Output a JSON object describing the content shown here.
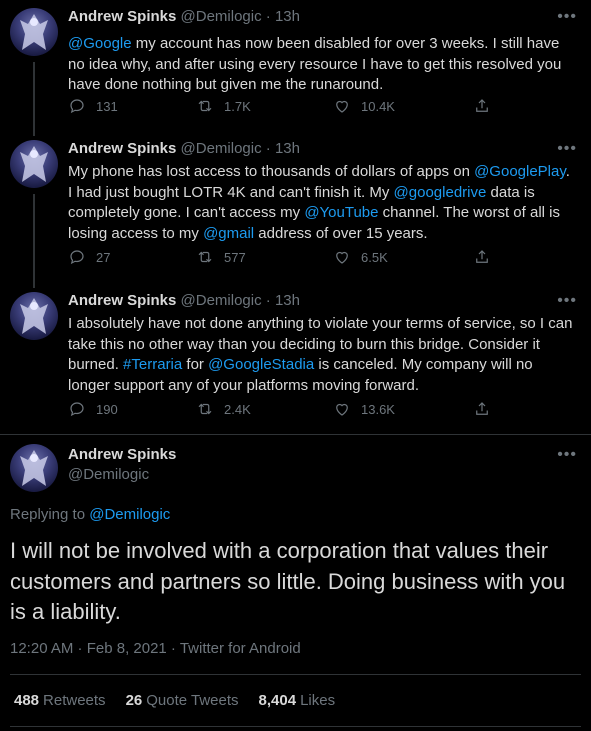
{
  "tweets": [
    {
      "name": "Andrew Spinks",
      "handle": "@Demilogic",
      "dot": "·",
      "time": "13h",
      "text": [
        {
          "t": "@Google",
          "m": true
        },
        {
          "t": " my account has now been disabled for over 3 weeks. I still have no idea why, and after using every resource I have to get this resolved you have done nothing but given me the runaround.",
          "m": false
        }
      ],
      "replies": "131",
      "retweets": "1.7K",
      "likes": "10.4K"
    },
    {
      "name": "Andrew Spinks",
      "handle": "@Demilogic",
      "dot": "·",
      "time": "13h",
      "text": [
        {
          "t": "My phone has lost access to thousands of dollars of apps on ",
          "m": false
        },
        {
          "t": "@GooglePlay",
          "m": true
        },
        {
          "t": ". I had just bought LOTR 4K and can't finish it. My ",
          "m": false
        },
        {
          "t": "@googledrive",
          "m": true
        },
        {
          "t": " data is completely gone. I can't access my ",
          "m": false
        },
        {
          "t": "@YouTube",
          "m": true
        },
        {
          "t": " channel. The worst of all is losing access to my ",
          "m": false
        },
        {
          "t": "@gmail",
          "m": true
        },
        {
          "t": " address of over 15 years.",
          "m": false
        }
      ],
      "replies": "27",
      "retweets": "577",
      "likes": "6.5K"
    },
    {
      "name": "Andrew Spinks",
      "handle": "@Demilogic",
      "dot": "·",
      "time": "13h",
      "text": [
        {
          "t": "I absolutely have not done anything to violate your terms of service, so I can take this no other way than you deciding to burn this bridge. Consider it burned. ",
          "m": false
        },
        {
          "t": "#Terraria",
          "m": true
        },
        {
          "t": " for ",
          "m": false
        },
        {
          "t": "@GoogleStadia",
          "m": true
        },
        {
          "t": " is canceled. My company will no longer support any of your platforms moving forward.",
          "m": false
        }
      ],
      "replies": "190",
      "retweets": "2.4K",
      "likes": "13.6K"
    }
  ],
  "main": {
    "name": "Andrew Spinks",
    "handle": "@Demilogic",
    "replying_prefix": "Replying to ",
    "replying_to": "@Demilogic",
    "text": "I will not be involved with a corporation that values their customers and partners so little. Doing business with you is a liability.",
    "meta": "12:20 AM · Feb 8, 2021 · Twitter for Android",
    "stats": [
      {
        "num": "488",
        "label": "Retweets"
      },
      {
        "num": "26",
        "label": "Quote Tweets"
      },
      {
        "num": "8,404",
        "label": "Likes"
      }
    ]
  },
  "icons": {
    "more": "•••",
    "accent": "#1d9bf0",
    "muted": "#6e767d"
  }
}
